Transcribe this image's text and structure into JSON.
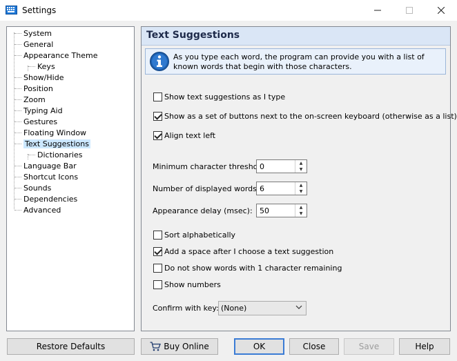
{
  "window": {
    "title": "Settings",
    "minimize_icon": "minimize-icon",
    "maximize_icon": "maximize-icon",
    "close_icon": "close-icon"
  },
  "tree": {
    "items": [
      {
        "label": "System",
        "level": 0
      },
      {
        "label": "General",
        "level": 0
      },
      {
        "label": "Appearance Theme",
        "level": 0
      },
      {
        "label": "Keys",
        "level": 1
      },
      {
        "label": "Show/Hide",
        "level": 0
      },
      {
        "label": "Position",
        "level": 0
      },
      {
        "label": "Zoom",
        "level": 0
      },
      {
        "label": "Typing Aid",
        "level": 0
      },
      {
        "label": "Gestures",
        "level": 0
      },
      {
        "label": "Floating Window",
        "level": 0
      },
      {
        "label": "Text Suggestions",
        "level": 0,
        "selected": true
      },
      {
        "label": "Dictionaries",
        "level": 1
      },
      {
        "label": "Language Bar",
        "level": 0
      },
      {
        "label": "Shortcut Icons",
        "level": 0
      },
      {
        "label": "Sounds",
        "level": 0
      },
      {
        "label": "Dependencies",
        "level": 0
      },
      {
        "label": "Advanced",
        "level": 0
      }
    ]
  },
  "panel": {
    "title": "Text Suggestions",
    "info_icon": "info-icon",
    "info_text": "As you type each word, the program can provide you with a list of known words that begin with those characters.",
    "checks1": [
      {
        "label": "Show text suggestions as I type",
        "checked": false
      },
      {
        "label": "Show as a set of buttons next to the on-screen keyboard (otherwise as a list)",
        "checked": true
      },
      {
        "label": "Align text left",
        "checked": true
      }
    ],
    "fields": [
      {
        "label": "Minimum character threshold:",
        "value": "0"
      },
      {
        "label": "Number of displayed words:",
        "value": "6"
      },
      {
        "label": "Appearance delay (msec):",
        "value": "50"
      }
    ],
    "checks2": [
      {
        "label": "Sort alphabetically",
        "checked": false
      },
      {
        "label": "Add a space after I choose a text suggestion",
        "checked": true
      },
      {
        "label": "Do not show words with 1 character remaining",
        "checked": false
      },
      {
        "label": "Show numbers",
        "checked": false
      }
    ],
    "confirm_label": "Confirm with key:",
    "confirm_value": "(None)"
  },
  "buttons": {
    "restore": "Restore Defaults",
    "buy": "Buy Online",
    "ok": "OK",
    "close": "Close",
    "save": "Save",
    "help": "Help"
  }
}
